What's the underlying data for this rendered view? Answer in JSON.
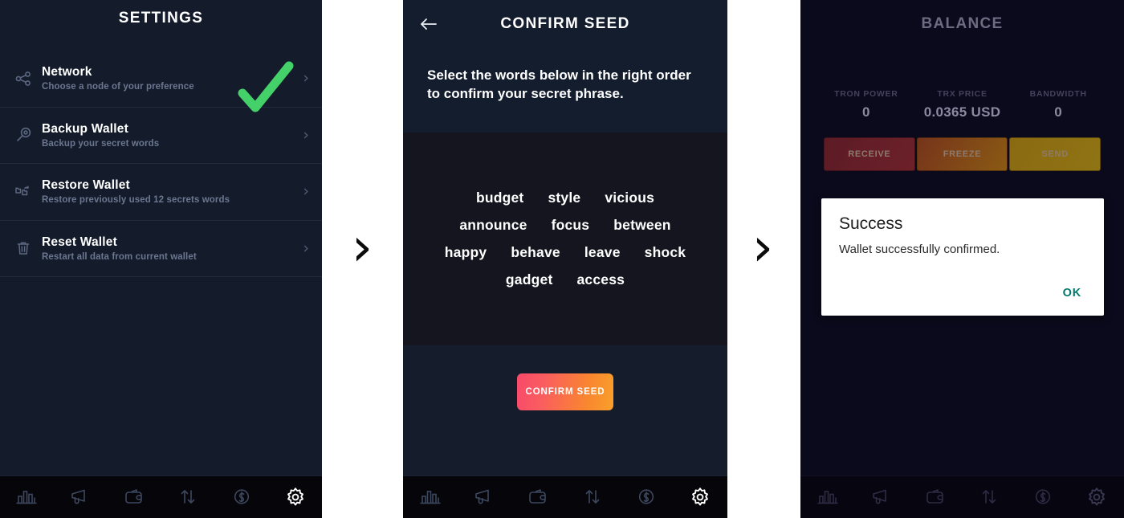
{
  "flow": {
    "arrow_glyph": "›"
  },
  "settings_screen": {
    "title": "SETTINGS",
    "annotation_icon": "green-check-mark",
    "annotation_color": "#44d16a",
    "rows": [
      {
        "title": "Network",
        "subtitle": "Choose a node of your preference",
        "icon": "share-node-icon",
        "chevron": "›"
      },
      {
        "title": "Backup Wallet",
        "subtitle": "Backup your secret words",
        "icon": "key-icon",
        "chevron": "›"
      },
      {
        "title": "Restore Wallet",
        "subtitle": "Restore previously used 12 secrets words",
        "icon": "restore-folders-icon",
        "chevron": "›"
      },
      {
        "title": "Reset Wallet",
        "subtitle": "Restart all data from current wallet",
        "icon": "trash-icon",
        "chevron": "›"
      }
    ]
  },
  "seed_screen": {
    "title": "CONFIRM SEED",
    "back_icon": "arrow-left-icon",
    "instruction": "Select the words below in the right order to confirm your secret phrase.",
    "word_rows": [
      [
        "budget",
        "style",
        "vicious"
      ],
      [
        "announce",
        "focus",
        "between"
      ],
      [
        "happy",
        "behave",
        "leave",
        "shock"
      ],
      [
        "gadget",
        "access"
      ]
    ],
    "confirm_button": "CONFIRM SEED",
    "confirm_button_gradient": [
      "#f7496b",
      "#f9a02b"
    ]
  },
  "balance_screen": {
    "title": "BALANCE",
    "stats": [
      {
        "label": "TRON POWER",
        "value": "0"
      },
      {
        "label": "TRX PRICE",
        "value": "0.0365 USD"
      },
      {
        "label": "BANDWIDTH",
        "value": "0"
      }
    ],
    "actions": [
      {
        "label": "RECEIVE",
        "color": "#6d2129"
      },
      {
        "label": "FREEZE",
        "color": "#8a5a13"
      },
      {
        "label": "SEND",
        "color": "#8f7414"
      }
    ],
    "dialog": {
      "title": "Success",
      "message": "Wallet successfully confirmed.",
      "ok_label": "OK",
      "ok_color": "#00796b"
    }
  },
  "bottom_nav": {
    "items": [
      {
        "name": "chart",
        "icon": "bar-chart-icon"
      },
      {
        "name": "announcements",
        "icon": "megaphone-icon"
      },
      {
        "name": "wallet",
        "icon": "wallet-icon"
      },
      {
        "name": "transfers",
        "icon": "transfer-arrows-icon"
      },
      {
        "name": "price",
        "icon": "dollar-circle-icon"
      },
      {
        "name": "settings",
        "icon": "gear-icon"
      }
    ]
  }
}
